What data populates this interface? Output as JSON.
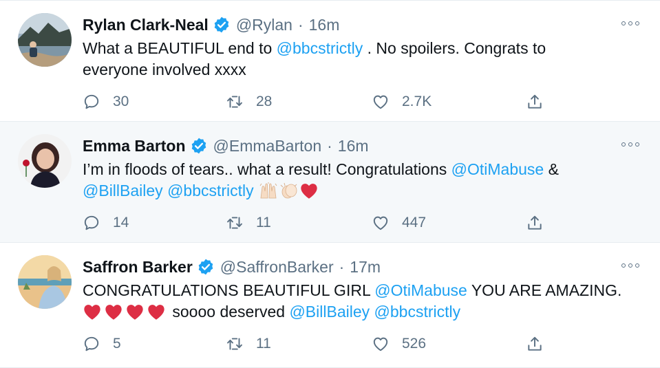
{
  "tweets": [
    {
      "name": "Rylan Clark-Neal",
      "handle": "@Rylan",
      "separator": "·",
      "time": "16m",
      "text_lines": [
        [
          {
            "t": "What a BEAUTIFUL end to ",
            "link": false
          },
          {
            "t": "@bbcstrictly",
            "link": true
          },
          {
            "t": " . No spoilers. Congrats to",
            "link": false
          }
        ],
        [
          {
            "t": "everyone involved xxxx",
            "link": false
          }
        ]
      ],
      "replies": "30",
      "retweets": "28",
      "likes": "2.7K"
    },
    {
      "name": "Emma Barton",
      "handle": "@EmmaBarton",
      "separator": "·",
      "time": "16m",
      "text_lines": [
        [
          {
            "t": "I’m in floods of tears.. what a result! Congratulations ",
            "link": false
          },
          {
            "t": "@OtiMabuse",
            "link": true
          },
          {
            "t": " &",
            "link": false
          }
        ],
        [
          {
            "t": "@BillBailey",
            "link": true
          },
          {
            "t": " ",
            "link": false
          },
          {
            "t": "@bbcstrictly",
            "link": true
          },
          {
            "t": " ",
            "link": false
          }
        ]
      ],
      "replies": "14",
      "retweets": "11",
      "likes": "447"
    },
    {
      "name": "Saffron Barker",
      "handle": "@SaffronBarker",
      "separator": "·",
      "time": "17m",
      "text_lines": [
        [
          {
            "t": "CONGRATULATIONS BEAUTIFUL GIRL ",
            "link": false
          },
          {
            "t": "@OtiMabuse",
            "link": true
          },
          {
            "t": " YOU ARE AMAZING.",
            "link": false
          }
        ],
        [
          {
            "t": " soooo deserved ",
            "link": false
          },
          {
            "t": "@BillBailey",
            "link": true
          },
          {
            "t": " ",
            "link": false
          },
          {
            "t": "@bbcstrictly",
            "link": true
          }
        ]
      ],
      "replies": "5",
      "retweets": "11",
      "likes": "526"
    }
  ],
  "icons": {
    "verified": "verified-badge-icon",
    "more": "more-options-icon",
    "reply": "reply-icon",
    "retweet": "retweet-icon",
    "like": "like-icon",
    "share": "share-icon"
  },
  "colors": {
    "link": "#1da1f2",
    "muted": "#5b7083",
    "verified": "#1da1f2",
    "highlight_bg": "#f5f8fa",
    "heart": "#e0245e"
  }
}
